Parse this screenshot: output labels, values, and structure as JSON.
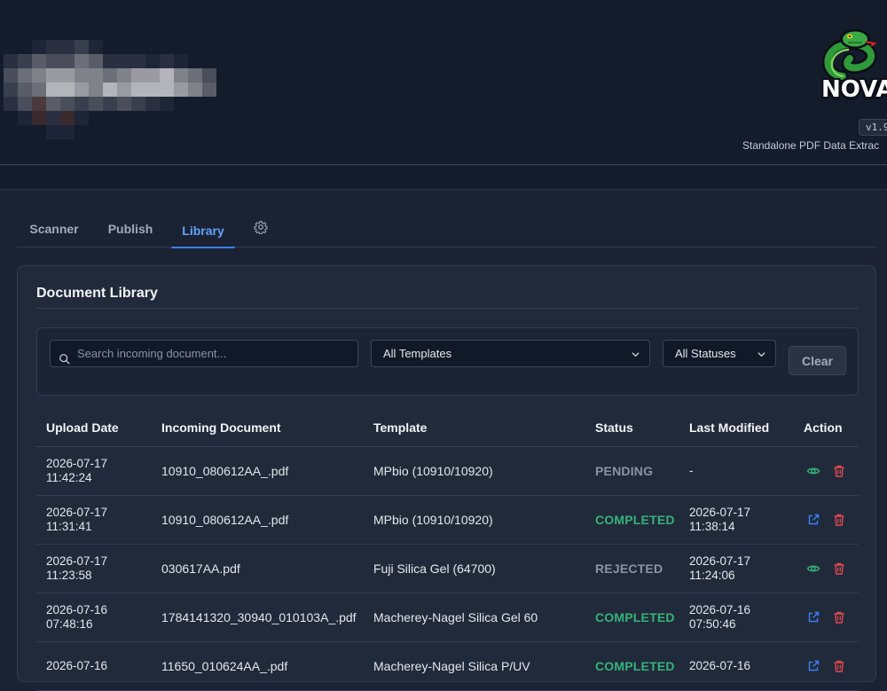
{
  "header": {
    "brand_name": "NOVA",
    "version": "v1.9",
    "subtitle": "Standalone PDF Data Extrac"
  },
  "tabs": [
    {
      "label": "Scanner"
    },
    {
      "label": "Publish"
    },
    {
      "label": "Library",
      "active": true
    }
  ],
  "panel": {
    "title": "Document Library"
  },
  "filters": {
    "search_placeholder": "Search incoming document...",
    "template_select": "All Templates",
    "status_select": "All Statuses",
    "clear_label": "Clear"
  },
  "table": {
    "columns": [
      "Upload Date",
      "Incoming Document",
      "Template",
      "Status",
      "Last Modified",
      "Action"
    ],
    "rows": [
      {
        "upload_date": "2026-07-17",
        "upload_time": "11:42:24",
        "document": "10910_080612AA_.pdf",
        "template": "MPbio (10910/10920)",
        "status": "PENDING",
        "modified_date": "-",
        "modified_time": "",
        "action": "view"
      },
      {
        "upload_date": "2026-07-17",
        "upload_time": "11:31:41",
        "document": "10910_080612AA_.pdf",
        "template": "MPbio (10910/10920)",
        "status": "COMPLETED",
        "modified_date": "2026-07-17",
        "modified_time": "11:38:14",
        "action": "open"
      },
      {
        "upload_date": "2026-07-17",
        "upload_time": "11:23:58",
        "document": "030617AA.pdf",
        "template": "Fuji Silica Gel (64700)",
        "status": "REJECTED",
        "modified_date": "2026-07-17",
        "modified_time": "11:24:06",
        "action": "view"
      },
      {
        "upload_date": "2026-07-16",
        "upload_time": "07:48:16",
        "document": "1784141320_30940_010103A_.pdf",
        "template": "Macherey-Nagel Silica Gel 60",
        "status": "COMPLETED",
        "modified_date": "2026-07-16",
        "modified_time": "07:50:46",
        "action": "open"
      },
      {
        "upload_date": "2026-07-16",
        "upload_time": "",
        "document": "11650_010624AA_.pdf",
        "template": "Macherey-Nagel Silica P/UV",
        "status": "COMPLETED",
        "modified_date": "2026-07-16",
        "modified_time": "",
        "action": "open"
      }
    ]
  },
  "colors": {
    "accent": "#3b82f6",
    "completed": "#34b37a",
    "muted_status": "#8b93a3",
    "view_icon": "#34b37a",
    "open_icon": "#3b82f6",
    "delete_icon": "#e5484d"
  }
}
